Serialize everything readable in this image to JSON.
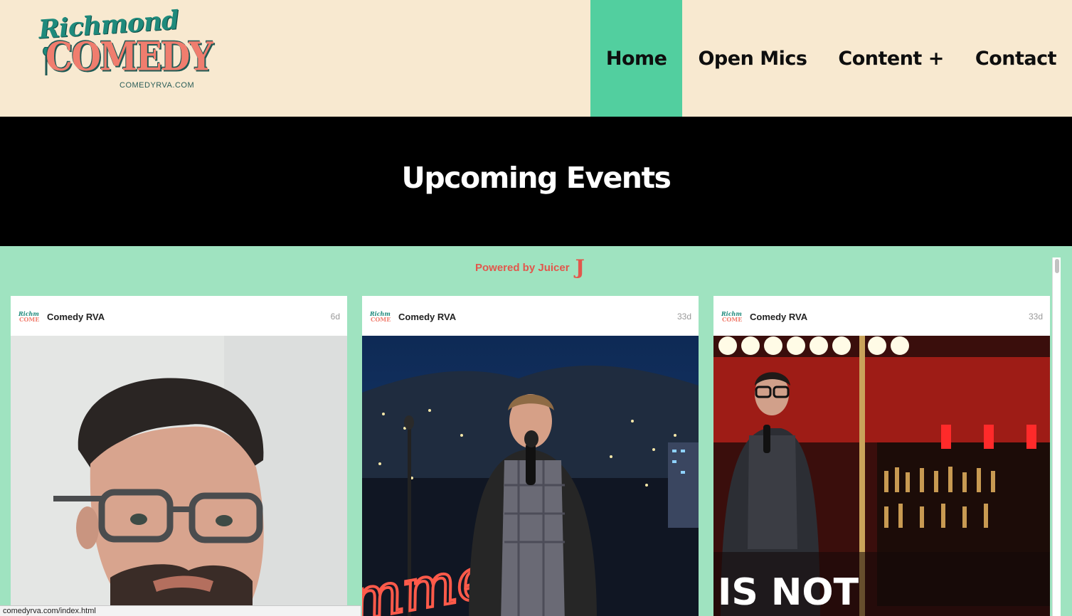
{
  "logo": {
    "script_text": "Richmond",
    "main_text": "COMEDY",
    "sub_text": "COMEDYRVA.COM"
  },
  "nav": [
    {
      "label": "Home",
      "active": true
    },
    {
      "label": "Open Mics",
      "active": false
    },
    {
      "label": "Content +",
      "active": false
    },
    {
      "label": "Contact",
      "active": false
    }
  ],
  "banner": {
    "title": "Upcoming Events"
  },
  "feed": {
    "powered_by": "Powered by Juicer",
    "powered_icon": "J",
    "cards": [
      {
        "author": "Comedy RVA",
        "age": "6d",
        "image": "comedian-headshot-glasses"
      },
      {
        "author": "Comedy RVA",
        "age": "33d",
        "image": "comedian-on-stage-night-city"
      },
      {
        "author": "Comedy RVA",
        "age": "33d",
        "image": "comedian-on-stage-bar",
        "overlay_text": "IS NOT"
      }
    ]
  },
  "status_url": "comedyrva.com/index.html",
  "colors": {
    "header_bg": "#f8e9d0",
    "nav_active": "#52cf9f",
    "feed_bg": "#9fe3c0",
    "juicer_red": "#e2574c"
  }
}
